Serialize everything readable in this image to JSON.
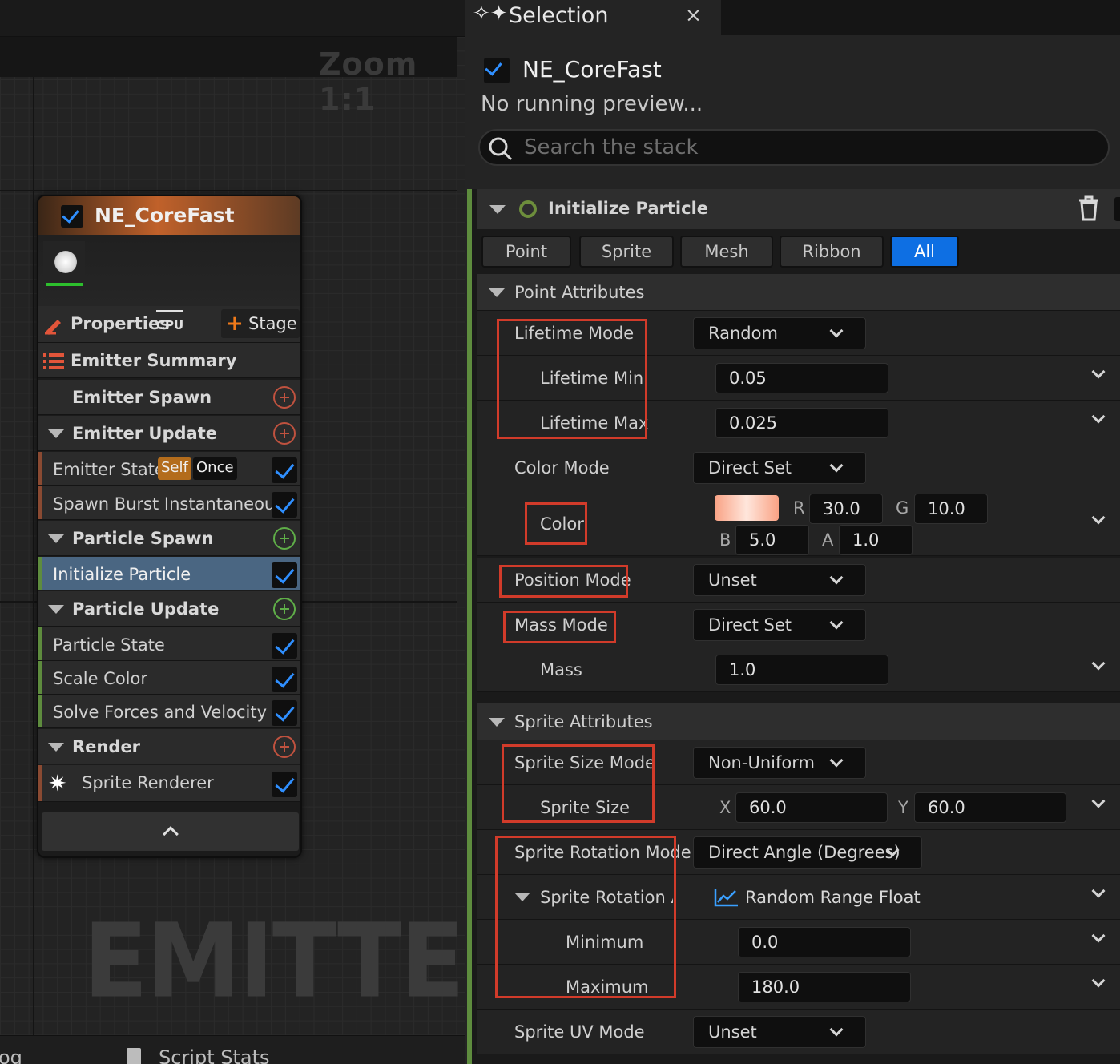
{
  "graph": {
    "zoom": "Zoom 1:1",
    "watermark": "EMITTER",
    "bottom_tabs": [
      "og",
      "Script Stats"
    ]
  },
  "node": {
    "title": "NE_CoreFast",
    "properties_label": "Properties",
    "cpu_badge": "CPU",
    "stage_label": "Stage",
    "rows": [
      {
        "label": "Emitter Summary",
        "type": "summary"
      },
      {
        "label": "Emitter Spawn",
        "type": "group",
        "add": "red"
      },
      {
        "label": "Emitter Update",
        "type": "group",
        "add": "red",
        "expanded": true
      },
      {
        "label": "Emitter State",
        "type": "item",
        "badges": [
          "Self",
          "Once"
        ],
        "checked": true
      },
      {
        "label": "Spawn Burst Instantaneous",
        "type": "item",
        "checked": true
      },
      {
        "label": "Particle Spawn",
        "type": "group",
        "add": "green",
        "expanded": true
      },
      {
        "label": "Initialize Particle",
        "type": "item",
        "checked": true,
        "selected": true
      },
      {
        "label": "Particle Update",
        "type": "group",
        "add": "green",
        "expanded": true
      },
      {
        "label": "Particle State",
        "type": "item",
        "checked": true
      },
      {
        "label": "Scale Color",
        "type": "item",
        "checked": true
      },
      {
        "label": "Solve Forces and Velocity",
        "type": "item",
        "checked": true
      },
      {
        "label": "Render",
        "type": "group",
        "add": "red",
        "expanded": true
      },
      {
        "label": "Sprite Renderer",
        "type": "item",
        "checked": true
      }
    ]
  },
  "panel": {
    "tab_title": "Selection",
    "tab_close": "×",
    "selection_name": "NE_CoreFast",
    "preview_status": "No running preview...",
    "search_placeholder": "Search the stack",
    "module_title": "Initialize Particle",
    "filters": [
      "Point",
      "Sprite",
      "Mesh",
      "Ribbon",
      "All"
    ],
    "active_filter": "All",
    "point_section": "Point Attributes",
    "lifetime_mode": {
      "label": "Lifetime Mode",
      "value": "Random"
    },
    "lifetime_min": {
      "label": "Lifetime Min",
      "value": "0.05"
    },
    "lifetime_max": {
      "label": "Lifetime Max",
      "value": "0.025"
    },
    "color_mode": {
      "label": "Color Mode",
      "value": "Direct Set"
    },
    "color": {
      "label": "Color",
      "r_label": "R",
      "r": "30.0",
      "g_label": "G",
      "g": "10.0",
      "b_label": "B",
      "b": "5.0",
      "a_label": "A",
      "a": "1.0",
      "swatch": "#ffb49a"
    },
    "position_mode": {
      "label": "Position Mode",
      "value": "Unset"
    },
    "mass_mode": {
      "label": "Mass Mode",
      "value": "Direct Set"
    },
    "mass": {
      "label": "Mass",
      "value": "1.0"
    },
    "sprite_section": "Sprite Attributes",
    "sprite_size_mode": {
      "label": "Sprite Size Mode",
      "value": "Non-Uniform"
    },
    "sprite_size": {
      "label": "Sprite Size",
      "x_label": "X",
      "x": "60.0",
      "y_label": "Y",
      "y": "60.0"
    },
    "sprite_rotation_mode": {
      "label": "Sprite Rotation Mode",
      "value": "Direct Angle (Degrees)"
    },
    "sprite_rotation_angle": {
      "label": "Sprite Rotation Ar",
      "value": "Random Range Float"
    },
    "minimum": {
      "label": "Minimum",
      "value": "0.0"
    },
    "maximum": {
      "label": "Maximum",
      "value": "180.0"
    },
    "sprite_uv_mode": {
      "label": "Sprite UV Mode",
      "value": "Unset"
    }
  },
  "colors": {
    "accent_blue": "#0e6fe3",
    "check_blue": "#2f8fff",
    "highlight_red": "#d13b2a",
    "node_header_orange": "#c0612a",
    "module_green": "#5e8c3e"
  }
}
